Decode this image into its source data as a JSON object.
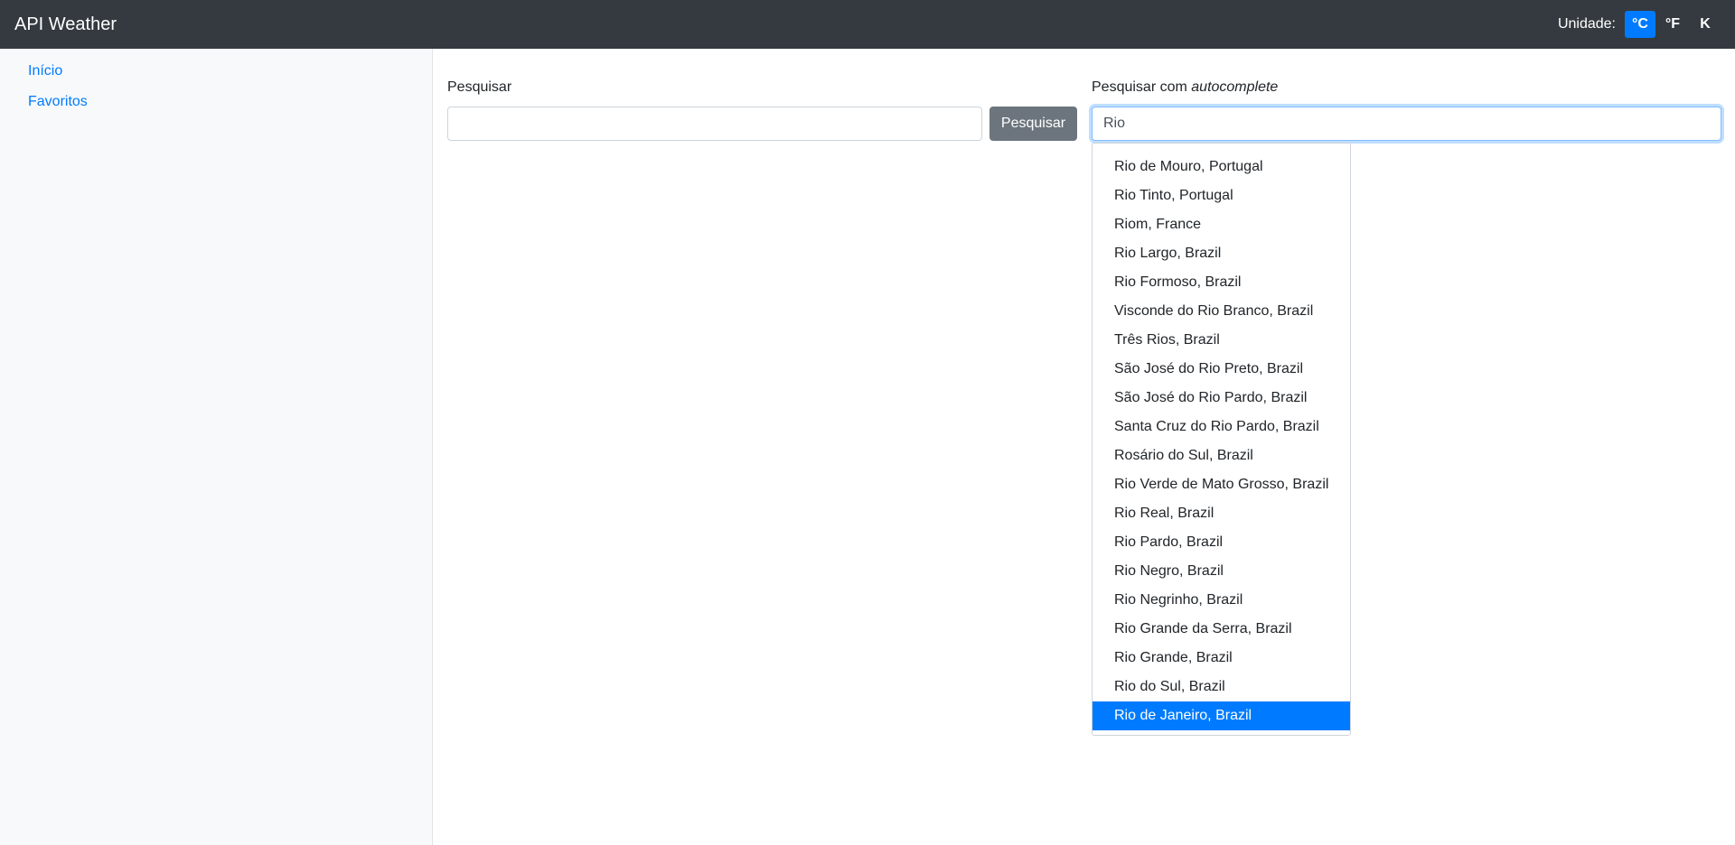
{
  "navbar": {
    "brand": "API Weather",
    "units_label": "Unidade:",
    "units": [
      {
        "label": "°C",
        "active": true
      },
      {
        "label": "°F",
        "active": false
      },
      {
        "label": "K",
        "active": false
      }
    ]
  },
  "sidebar": {
    "items": [
      {
        "label": "Início"
      },
      {
        "label": "Favoritos"
      }
    ]
  },
  "search": {
    "label": "Pesquisar",
    "value": "",
    "button_label": "Pesquisar"
  },
  "autocomplete": {
    "label_prefix": "Pesquisar com ",
    "label_emphasis": "autocomplete",
    "value": "Rio",
    "suggestions": [
      "Rio de Mouro, Portugal",
      "Rio Tinto, Portugal",
      "Riom, France",
      "Rio Largo, Brazil",
      "Rio Formoso, Brazil",
      "Visconde do Rio Branco, Brazil",
      "Três Rios, Brazil",
      "São José do Rio Preto, Brazil",
      "São José do Rio Pardo, Brazil",
      "Santa Cruz do Rio Pardo, Brazil",
      "Rosário do Sul, Brazil",
      "Rio Verde de Mato Grosso, Brazil",
      "Rio Real, Brazil",
      "Rio Pardo, Brazil",
      "Rio Negro, Brazil",
      "Rio Negrinho, Brazil",
      "Rio Grande da Serra, Brazil",
      "Rio Grande, Brazil",
      "Rio do Sul, Brazil",
      "Rio de Janeiro, Brazil"
    ],
    "selected_index": 19
  },
  "colors": {
    "navbar_bg": "#343a40",
    "accent": "#007bff",
    "sidebar_bg": "#f8f9fa",
    "button_secondary": "#6c757d"
  }
}
